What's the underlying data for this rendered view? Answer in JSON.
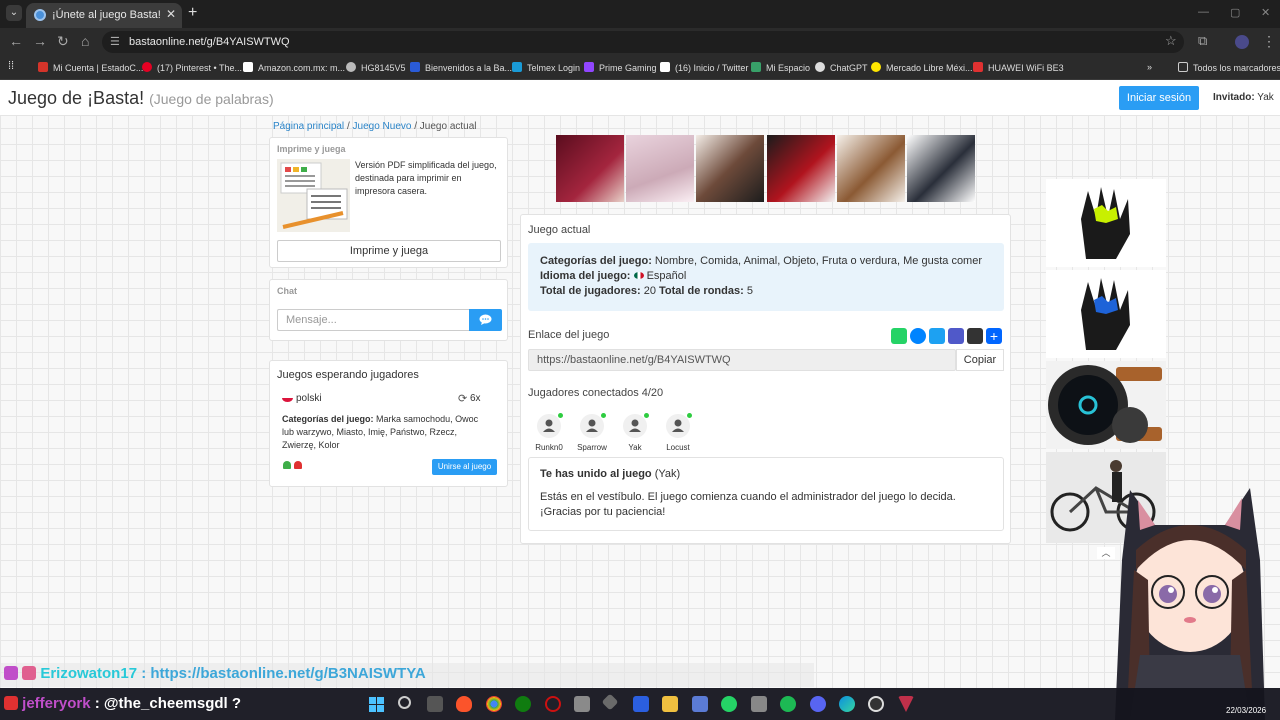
{
  "browser": {
    "tab_title": "¡Únete al juego Basta!",
    "url": "bastaonline.net/g/B4YAISWTWQ",
    "bookmarks": [
      {
        "label": "Mi Cuenta | EstadoC...",
        "color": "#d4342a"
      },
      {
        "label": "(17) Pinterest • The...",
        "color": "#e60023"
      },
      {
        "label": "Amazon.com.mx: m...",
        "color": "#ffffff"
      },
      {
        "label": "HG8145V5",
        "color": "#bbbbbb"
      },
      {
        "label": "Bienvenidos a la Ba...",
        "color": "#2a5bd7"
      },
      {
        "label": "Telmex Login",
        "color": "#1a9bd7"
      },
      {
        "label": "Prime Gaming",
        "color": "#9146ff"
      },
      {
        "label": "(16) Inicio / Twitter",
        "color": "#ffffff"
      },
      {
        "label": "Mi Espacio",
        "color": "#38a169"
      },
      {
        "label": "ChatGPT",
        "color": "#dddddd"
      },
      {
        "label": "Mercado Libre Méxi...",
        "color": "#ffe600"
      },
      {
        "label": "HUAWEI WiFi BE3",
        "color": "#e03131"
      }
    ],
    "all_bookmarks": "Todos los marcadores"
  },
  "header": {
    "title": "Juego de ¡Basta!",
    "subtitle": "(Juego de palabras)",
    "login_button": "Iniciar sesión",
    "invited_label": "Invitado:",
    "invited_name": "Yak"
  },
  "breadcrumb": {
    "home": "Página principal",
    "new_game": "Juego Nuevo",
    "sep": "/",
    "current": "Juego actual"
  },
  "print_panel": {
    "title": "Imprime y juega",
    "description": "Versión PDF simplificada del juego, destinada para imprimir en impresora casera.",
    "button": "Imprime y juega"
  },
  "chat_panel": {
    "title": "Chat",
    "placeholder": "Mensaje..."
  },
  "waiting_panel": {
    "title": "Juegos esperando jugadores",
    "game": {
      "language": "polski",
      "count": "6x",
      "categories_label": "Categorías del juego:",
      "categories": "Marka samochodu, Owoc lub warzywo, Miasto, Imię, Państwo, Rzecz, Zwierzę, Kolor",
      "join_button": "Unirse al juego"
    }
  },
  "current_game": {
    "section_title": "Juego actual",
    "categories_label": "Categorías del juego:",
    "categories": "Nombre, Comida, Animal, Objeto, Fruta o verdura, Me gusta comer",
    "language_label": "Idioma del juego:",
    "language": "Español",
    "players_label": "Total de jugadores:",
    "players": "20",
    "rounds_label": "Total de rondas:",
    "rounds": "5",
    "link_label": "Enlace del juego",
    "link": "https://bastaonline.net/g/B4YAISWTWQ",
    "copy_button": "Copiar",
    "connected_label": "Jugadores conectados 4/20",
    "players_list": [
      "Runkn0",
      "Sparrow",
      "Yak",
      "Locust"
    ],
    "joined_title": "Te has unido al juego",
    "joined_name": "(Yak)",
    "joined_message": "Estás en el vestíbulo. El juego comienza cuando el administrador del juego lo decida. ¡Gracias por tu paciencia!"
  },
  "overlay": {
    "user1": "Erizowaton17",
    "msg1": ": https://bastaonline.net/g/B3NAISWTYA",
    "user2": "jefferyork",
    "msg2": ": @the_cheemsgdl ?"
  },
  "taskbar": {
    "date": "22/03/2026"
  }
}
